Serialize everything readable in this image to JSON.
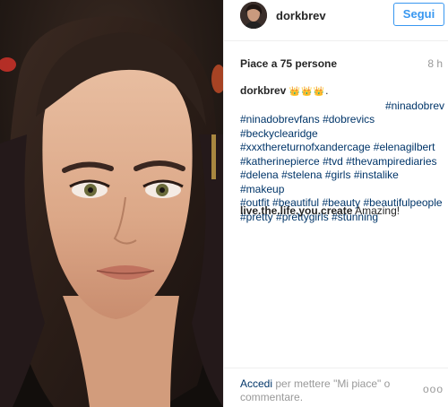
{
  "post": {
    "username": "dorkbrev",
    "follow_label": "Segui",
    "likes": "Piace a 75 persone",
    "time": "8 h",
    "caption": {
      "user": "dorkbrev",
      "crowns": "👑👑👑",
      "punct": ".",
      "first_tag": "#ninadobrev",
      "tags": [
        "#ninadobrevfans",
        "#dobrevics",
        "#beckyclearidge",
        "#xxxthereturnofxandercage",
        "#elenagilbert",
        "#katherinepierce",
        "#tvd",
        "#thevampirediaries",
        "#delena",
        "#stelena",
        "#girls",
        "#instalike",
        "#makeup",
        "#outfit",
        "#beautiful",
        "#beauty",
        "#beautifulpeople",
        "#pretty",
        "#prettygirls",
        "#stunning"
      ]
    },
    "comment": {
      "user": "live.the.life.you.create",
      "text": "Amazing!"
    }
  },
  "footer": {
    "login_link": "Accedi",
    "login_text": "per mettere \"Mi piace\" o commentare.",
    "more": "ooo"
  },
  "colors": {
    "accent": "#3897f0",
    "link": "#003569",
    "muted": "#999999",
    "text": "#262626"
  }
}
